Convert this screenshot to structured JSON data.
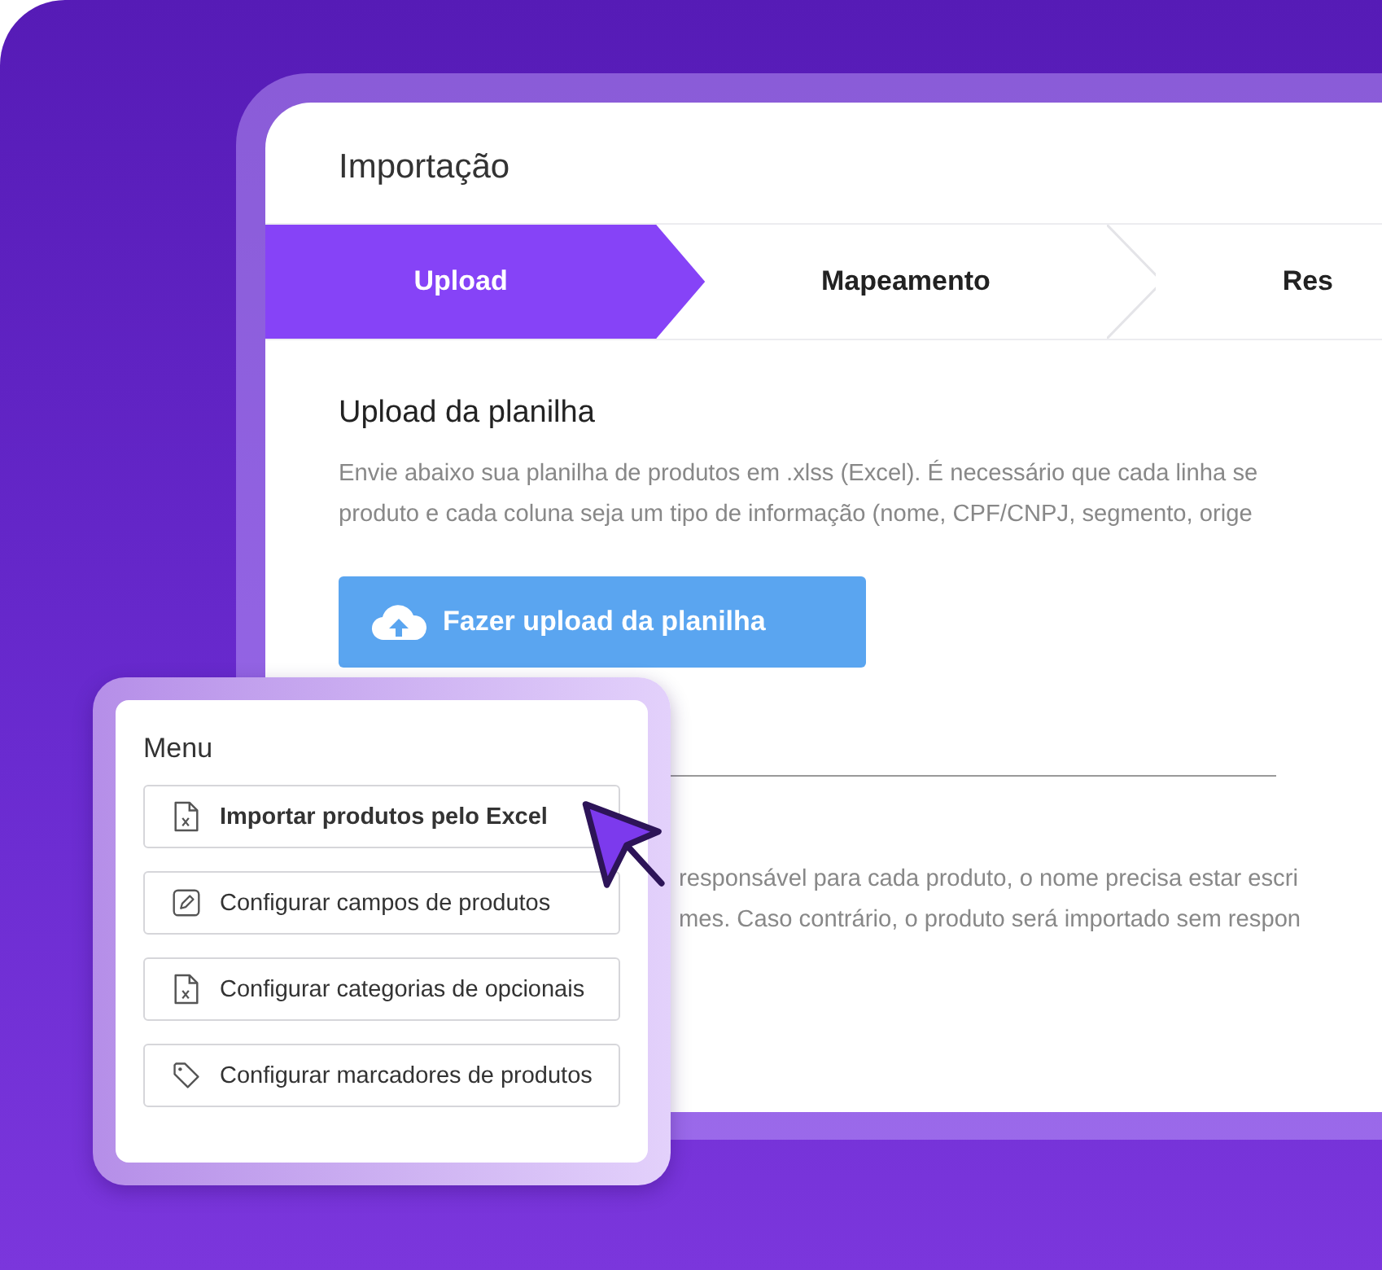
{
  "window": {
    "title": "Importação"
  },
  "steps": [
    {
      "label": "Upload",
      "selected": true
    },
    {
      "label": "Mapeamento",
      "selected": false
    },
    {
      "label": "Res",
      "selected": false
    }
  ],
  "upload_section": {
    "title": "Upload da planilha",
    "description_lines": [
      "Envie abaixo sua planilha de produtos em .xlss (Excel). É necessário que cada linha se",
      "produto e cada coluna seja um tipo de informação (nome, CPF/CNPJ, segmento, orige"
    ],
    "button": "Fazer upload da planilha"
  },
  "note_lines": [
    "responsável para cada produto, o nome precisa estar escri",
    "mes. Caso contrário, o produto será importado sem respon"
  ],
  "menu": {
    "title": "Menu",
    "items": [
      {
        "label": "Importar produtos pelo Excel",
        "kind": "spreadsheet",
        "selected": true
      },
      {
        "label": "Configurar campos de produtos",
        "kind": "edit",
        "selected": false
      },
      {
        "label": "Configurar categorias de opcionais",
        "kind": "spreadsheet",
        "selected": false
      },
      {
        "label": "Configurar marcadores de produtos",
        "kind": "tag",
        "selected": false
      }
    ]
  }
}
